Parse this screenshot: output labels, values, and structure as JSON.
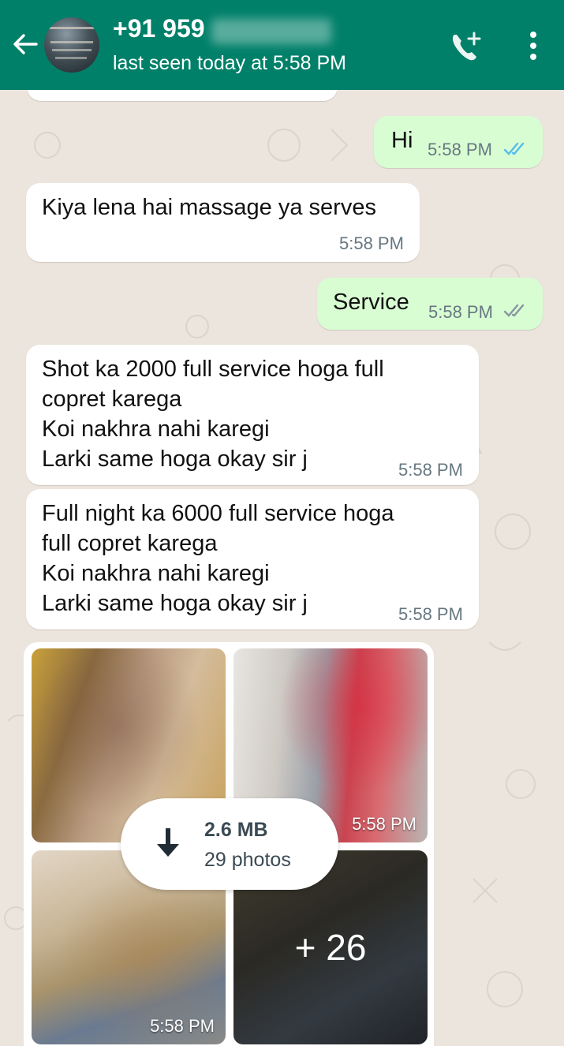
{
  "header": {
    "title": "+91 959",
    "subtitle": "last seen today at 5:58 PM",
    "bg_color": "#008069"
  },
  "messages": [
    {
      "type": "outgoing",
      "text": "Hi",
      "time": "5:58 PM",
      "status": "read"
    },
    {
      "type": "incoming",
      "text": "Kiya lena hai massage ya serves",
      "time": "5:58 PM"
    },
    {
      "type": "outgoing",
      "text": "Service",
      "time": "5:58 PM",
      "status": "delivered"
    },
    {
      "type": "incoming",
      "lines": [
        "Shot ka 2000 full service hoga full",
        "copret karega",
        "Koi nakhra nahi karegi",
        "Larki same hoga okay sir j"
      ],
      "time": "5:58 PM"
    },
    {
      "type": "incoming",
      "lines": [
        "Full night ka 6000  full service hoga",
        "full copret karega",
        "Koi nakhra nahi karegi",
        "Larki same hoga okay sir j"
      ],
      "time": "5:58 PM"
    }
  ],
  "media": {
    "size": "2.6 MB",
    "count": "29 photos",
    "more": "+ 26",
    "photo_time_top": "5:58 PM",
    "photo_time_bottom": "5:58 PM"
  },
  "icons": {
    "back": "arrow-left",
    "call": "add-call",
    "menu": "vertical-dots",
    "download": "arrow-down",
    "read_ticks": "double-check-blue",
    "delivered_ticks": "double-check-gray"
  },
  "colors": {
    "incoming": "#ffffff",
    "outgoing": "#D9FDD3",
    "read_tick": "#53BDEB",
    "time": "#667781"
  }
}
